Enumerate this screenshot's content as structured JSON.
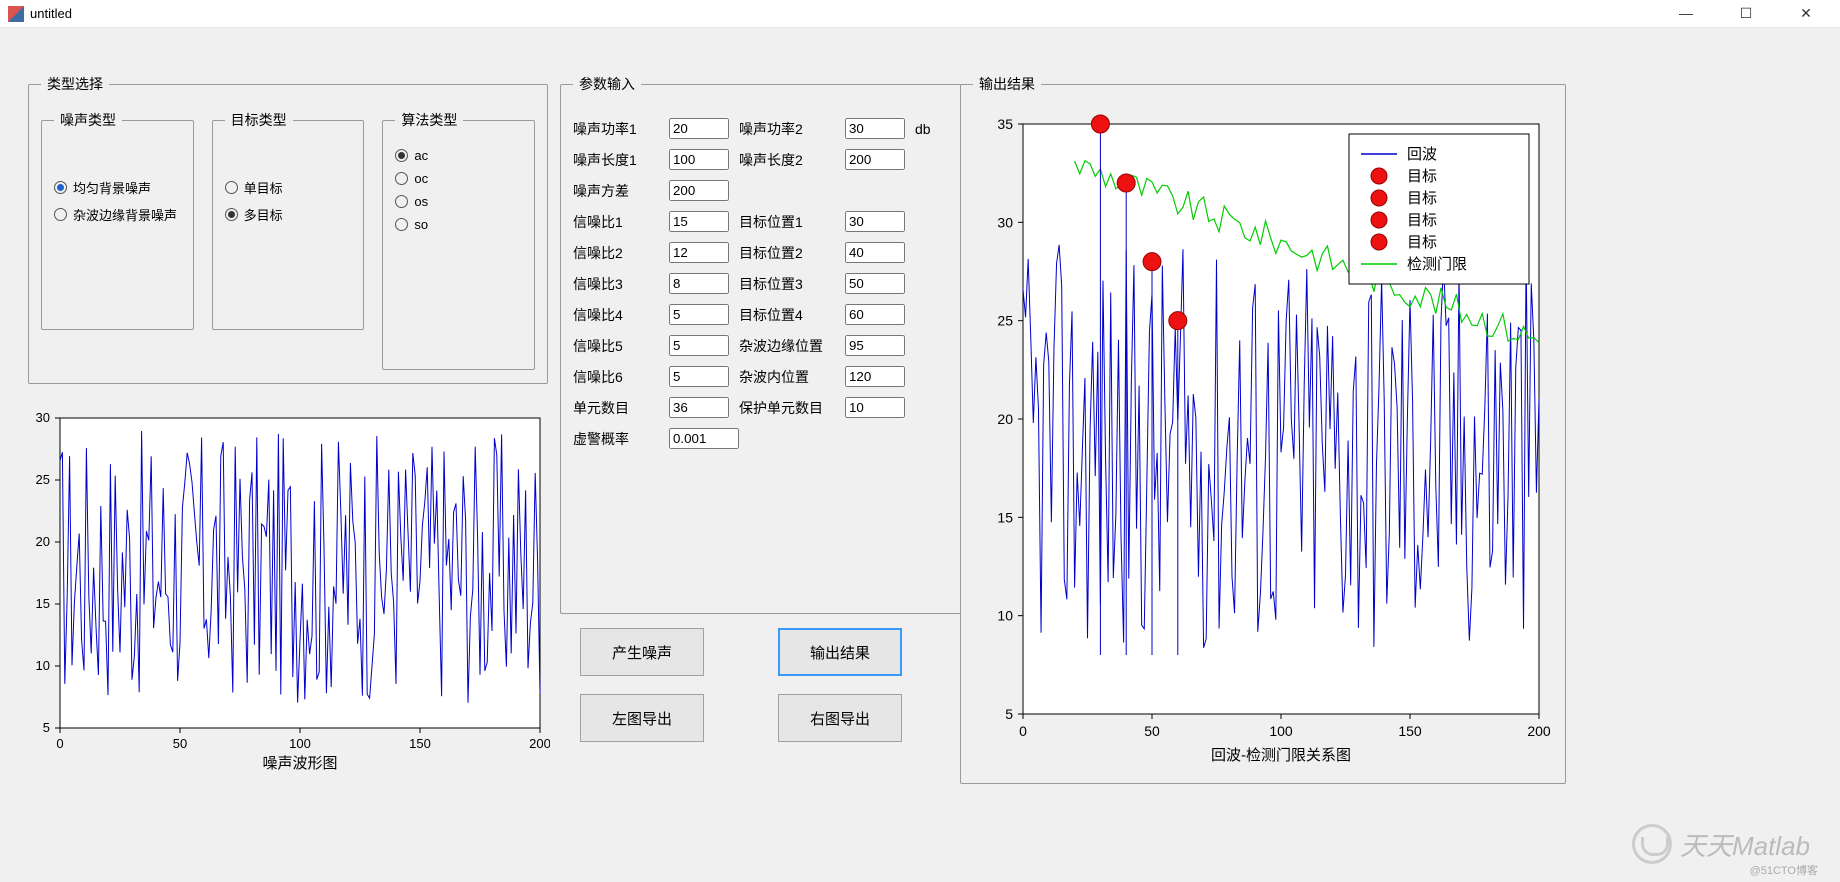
{
  "window": {
    "title": "untitled",
    "min": "—",
    "max": "☐",
    "close": "✕"
  },
  "panels": {
    "types": {
      "legend": "类型选择",
      "noise": {
        "legend": "噪声类型",
        "opt1": "均匀背景噪声",
        "opt2": "杂波边缘背景噪声",
        "selected": 0
      },
      "target": {
        "legend": "目标类型",
        "opt1": "单目标",
        "opt2": "多目标",
        "selected": 1
      },
      "algo": {
        "legend": "算法类型",
        "opt1": "ac",
        "opt2": "oc",
        "opt3": "os",
        "opt4": "so",
        "selected": 0
      }
    },
    "params": {
      "legend": "参数输入",
      "noise_power1_lbl": "噪声功率1",
      "noise_power1": "20",
      "noise_power2_lbl": "噪声功率2",
      "noise_power2": "30",
      "db": "db",
      "noise_len1_lbl": "噪声长度1",
      "noise_len1": "100",
      "noise_len2_lbl": "噪声长度2",
      "noise_len2": "200",
      "noise_var_lbl": "噪声方差",
      "noise_var": "200",
      "snr1_lbl": "信噪比1",
      "snr1": "15",
      "pos1_lbl": "目标位置1",
      "pos1": "30",
      "snr2_lbl": "信噪比2",
      "snr2": "12",
      "pos2_lbl": "目标位置2",
      "pos2": "40",
      "snr3_lbl": "信噪比3",
      "snr3": "8",
      "pos3_lbl": "目标位置3",
      "pos3": "50",
      "snr4_lbl": "信噪比4",
      "snr4": "5",
      "pos4_lbl": "目标位置4",
      "pos4": "60",
      "snr5_lbl": "信噪比5",
      "snr5": "5",
      "pos5_lbl": "杂波边缘位置",
      "pos5": "95",
      "snr6_lbl": "信噪比6",
      "snr6": "5",
      "pos6_lbl": "杂波内位置",
      "pos6": "120",
      "cells_lbl": "单元数目",
      "cells": "36",
      "guard_lbl": "保护单元数目",
      "guard": "10",
      "pfa_lbl": "虚警概率",
      "pfa": "0.001"
    },
    "output": {
      "legend": "输出结果"
    }
  },
  "buttons": {
    "gen": "产生噪声",
    "run": "输出结果",
    "expL": "左图导出",
    "expR": "右图导出"
  },
  "left_plot": {
    "title": "噪声波形图",
    "xticks": [
      "0",
      "50",
      "100",
      "150",
      "200"
    ],
    "yticks": [
      "5",
      "10",
      "15",
      "20",
      "25",
      "30"
    ]
  },
  "right_plot": {
    "title": "回波-检测门限关系图",
    "xticks": [
      "0",
      "50",
      "100",
      "150",
      "200"
    ],
    "yticks": [
      "5",
      "10",
      "15",
      "20",
      "25",
      "30",
      "35"
    ],
    "legend": [
      "回波",
      "目标",
      "目标",
      "目标",
      "目标",
      "检测门限"
    ]
  },
  "chart_data": [
    {
      "type": "line",
      "title": "噪声波形图",
      "xlabel": "",
      "ylabel": "",
      "xlim": [
        0,
        200
      ],
      "ylim": [
        5,
        30
      ],
      "series": [
        {
          "name": "noise",
          "values": "random noise signal fluctuating roughly between 7 and 29 across x=0..200"
        }
      ]
    },
    {
      "type": "line",
      "title": "回波-检测门限关系图",
      "xlabel": "",
      "ylabel": "",
      "xlim": [
        0,
        200
      ],
      "ylim": [
        5,
        35
      ],
      "series": [
        {
          "name": "回波",
          "color": "#0000cc",
          "values": "echo signal, dense noise-like 8..29 across 0..200 plus spikes near x=30,40,50,60"
        },
        {
          "name": "检测门限",
          "color": "#00cc00",
          "values": "threshold curve, starts ≈33 near x≈20, slowly descending to ≈24 by x≈200"
        }
      ],
      "markers": [
        {
          "name": "目标",
          "x": 30,
          "y": 35,
          "color": "#e11"
        },
        {
          "name": "目标",
          "x": 40,
          "y": 32,
          "color": "#e11"
        },
        {
          "name": "目标",
          "x": 50,
          "y": 28,
          "color": "#e11"
        },
        {
          "name": "目标",
          "x": 60,
          "y": 25,
          "color": "#e11"
        }
      ]
    }
  ],
  "watermark": "天天Matlab",
  "footer": "@51CTO博客"
}
